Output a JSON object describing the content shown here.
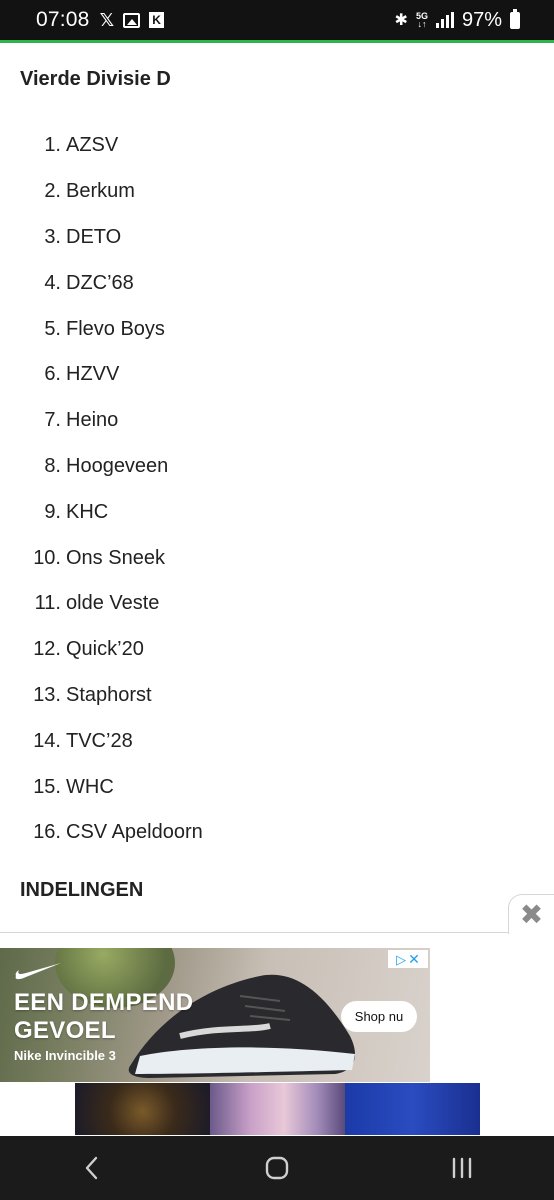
{
  "status_bar": {
    "time": "07:08",
    "battery": "97%",
    "accent_color": "#2db54b",
    "icons_left": [
      "x-icon",
      "image-icon",
      "k-app-icon"
    ],
    "icons_right": [
      "bluetooth-icon",
      "5g-icon",
      "signal-icon",
      "battery-icon"
    ]
  },
  "article": {
    "section_title": "Vierde Divisie D",
    "teams": [
      {
        "num": "1.",
        "name": "AZSV"
      },
      {
        "num": "2.",
        "name": "Berkum"
      },
      {
        "num": "3.",
        "name": "DETO"
      },
      {
        "num": "4.",
        "name": "DZC’68"
      },
      {
        "num": "5.",
        "name": "Flevo Boys"
      },
      {
        "num": "6.",
        "name": "HZVV"
      },
      {
        "num": "7.",
        "name": "Heino"
      },
      {
        "num": "8.",
        "name": "Hoogeveen"
      },
      {
        "num": "9.",
        "name": "KHC"
      },
      {
        "num": "10.",
        "name": "Ons Sneek"
      },
      {
        "num": "11.",
        "name": "olde Veste"
      },
      {
        "num": "12.",
        "name": "Quick’20"
      },
      {
        "num": "13.",
        "name": "Staphorst"
      },
      {
        "num": "14.",
        "name": "TVC’28"
      },
      {
        "num": "15.",
        "name": "WHC"
      },
      {
        "num": "16.",
        "name": "CSV Apeldoorn"
      }
    ],
    "next_section_title": "INDELINGEN"
  },
  "ad": {
    "close_glyph": "✖",
    "headline": "EEN DEMPEND GEVOEL",
    "product": "Nike Invincible 3",
    "cta": "Shop nu",
    "brand_logo": "nike-swoosh-icon",
    "ad_choices": "adchoices-icon"
  },
  "nav_bar": {
    "buttons": [
      "back-icon",
      "home-icon",
      "recents-icon"
    ]
  }
}
